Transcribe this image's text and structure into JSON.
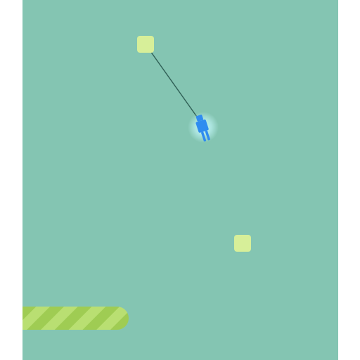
{
  "game": {
    "colors": {
      "background": "#84c5b2",
      "anchor": "#d7ef99",
      "rope": "#2f5f55",
      "player": "#2f8cf0",
      "player_glow": "#c9fbff",
      "floor_light": "#b9df72",
      "floor_dark": "#9fcc53"
    },
    "player": {
      "icon": "stick-figure-icon",
      "state": "swinging"
    },
    "rope": {
      "attached": true
    },
    "anchors": [
      {
        "name": "grapple-anchor-active",
        "active": true
      },
      {
        "name": "grapple-anchor-next",
        "active": false
      }
    ],
    "floor": {
      "pattern": "diagonal-stripes"
    }
  }
}
